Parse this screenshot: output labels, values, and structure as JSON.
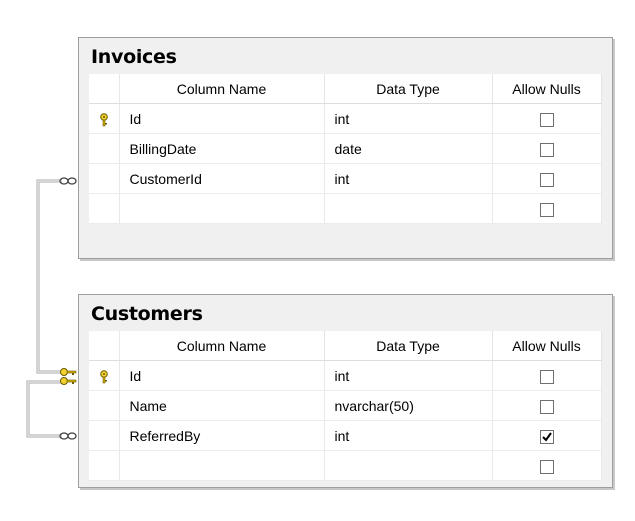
{
  "columns": {
    "name": "Column Name",
    "type": "Data Type",
    "nulls": "Allow Nulls"
  },
  "invoices": {
    "title": "Invoices",
    "rows": [
      {
        "name": "Id",
        "type": "int",
        "key": true,
        "allow_nulls": false
      },
      {
        "name": "BillingDate",
        "type": "date",
        "key": false,
        "allow_nulls": false
      },
      {
        "name": "CustomerId",
        "type": "int",
        "key": false,
        "allow_nulls": false
      },
      {
        "name": "",
        "type": "",
        "key": false,
        "allow_nulls": false
      }
    ]
  },
  "customers": {
    "title": "Customers",
    "rows": [
      {
        "name": "Id",
        "type": "int",
        "key": true,
        "allow_nulls": false
      },
      {
        "name": "Name",
        "type": "nvarchar(50)",
        "key": false,
        "allow_nulls": false
      },
      {
        "name": "ReferredBy",
        "type": "int",
        "key": false,
        "allow_nulls": true
      },
      {
        "name": "",
        "type": "",
        "key": false,
        "allow_nulls": false
      }
    ]
  },
  "relationships": [
    {
      "from": "Invoices.CustomerId",
      "to": "Customers.Id",
      "many_end": "infinity-icon",
      "one_end": "key-icon"
    },
    {
      "from": "Customers.ReferredBy",
      "to": "Customers.Id",
      "many_end": "infinity-icon",
      "one_end": "key-icon"
    }
  ]
}
